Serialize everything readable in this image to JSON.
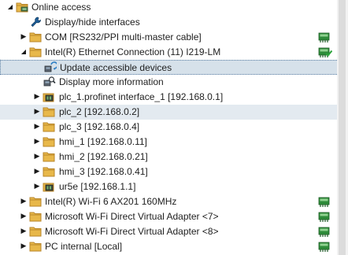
{
  "tree": {
    "rows": [
      {
        "name": "tree-item-online-access",
        "label": "Online access",
        "icon": "folder-network-icon",
        "arrow": "expanded",
        "level": 0,
        "status": "none"
      },
      {
        "name": "tree-item-display-hide-interfaces",
        "label": "Display/hide interfaces",
        "icon": "wrench-icon",
        "arrow": "none",
        "level": 1,
        "status": "none"
      },
      {
        "name": "tree-item-com-port",
        "label": "COM [RS232/PPI multi-master cable]",
        "icon": "folder-icon",
        "arrow": "collapsed",
        "level": 1,
        "status": "network-ok"
      },
      {
        "name": "tree-item-intel-ethernet",
        "label": "Intel(R) Ethernet Connection (11) I219-LM",
        "icon": "folder-icon",
        "arrow": "expanded",
        "level": 1,
        "status": "network-check"
      },
      {
        "name": "tree-item-update-accessible-devices",
        "label": "Update accessible devices",
        "icon": "update-devices-icon",
        "arrow": "none",
        "level": 2,
        "status": "none",
        "state": "selected"
      },
      {
        "name": "tree-item-display-more-information",
        "label": "Display more information",
        "icon": "info-search-icon",
        "arrow": "none",
        "level": 2,
        "status": "none"
      },
      {
        "name": "tree-item-plc-1",
        "label": "plc_1.profinet interface_1 [192.168.0.1]",
        "icon": "plc-device-icon",
        "arrow": "collapsed",
        "level": 2,
        "status": "none"
      },
      {
        "name": "tree-item-plc-2",
        "label": "plc_2 [192.168.0.2]",
        "icon": "folder-icon",
        "arrow": "collapsed",
        "level": 2,
        "status": "none",
        "state": "hover"
      },
      {
        "name": "tree-item-plc-3",
        "label": "plc_3 [192.168.0.4]",
        "icon": "folder-icon",
        "arrow": "collapsed",
        "level": 2,
        "status": "none"
      },
      {
        "name": "tree-item-hmi-1",
        "label": "hmi_1 [192.168.0.11]",
        "icon": "folder-icon",
        "arrow": "collapsed",
        "level": 2,
        "status": "none"
      },
      {
        "name": "tree-item-hmi-2",
        "label": "hmi_2 [192.168.0.21]",
        "icon": "folder-icon",
        "arrow": "collapsed",
        "level": 2,
        "status": "none"
      },
      {
        "name": "tree-item-hmi-3",
        "label": "hmi_3 [192.168.0.41]",
        "icon": "folder-icon",
        "arrow": "collapsed",
        "level": 2,
        "status": "none"
      },
      {
        "name": "tree-item-ur5e",
        "label": "ur5e [192.168.1.1]",
        "icon": "plc-device-icon",
        "arrow": "collapsed",
        "level": 2,
        "status": "none"
      },
      {
        "name": "tree-item-intel-wifi",
        "label": "Intel(R) Wi-Fi 6 AX201 160MHz",
        "icon": "folder-icon",
        "arrow": "collapsed",
        "level": 1,
        "status": "network-ok"
      },
      {
        "name": "tree-item-wifi-direct-7",
        "label": "Microsoft Wi-Fi Direct Virtual Adapter <7>",
        "icon": "folder-icon",
        "arrow": "collapsed",
        "level": 1,
        "status": "network-ok"
      },
      {
        "name": "tree-item-wifi-direct-8",
        "label": "Microsoft Wi-Fi Direct Virtual Adapter <8>",
        "icon": "folder-icon",
        "arrow": "collapsed",
        "level": 1,
        "status": "network-ok"
      },
      {
        "name": "tree-item-pc-internal",
        "label": "PC internal [Local]",
        "icon": "folder-icon",
        "arrow": "collapsed",
        "level": 1,
        "status": "network-ok"
      }
    ]
  },
  "colors": {
    "folder": "#e8b84a",
    "folder_dark": "#b8862a",
    "status_green": "#2e8b3a",
    "selection_bg": "#d6e1ea",
    "hover_bg": "#e3eaf0"
  }
}
